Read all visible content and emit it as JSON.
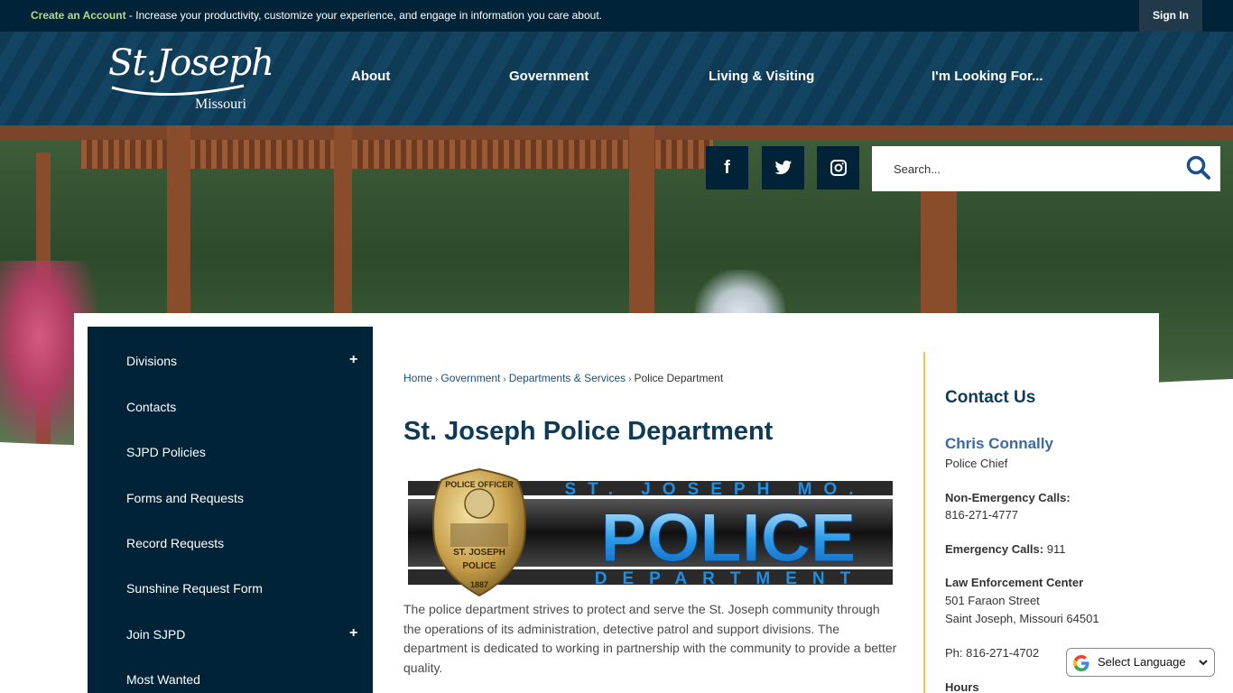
{
  "topbar": {
    "create_link": "Create an Account",
    "message": " - Increase your productivity, customize your experience, and engage in information you care about.",
    "sign_in": "Sign In"
  },
  "logo": {
    "city": "St.Joseph",
    "state": "Missouri"
  },
  "nav": [
    {
      "label": "About"
    },
    {
      "label": "Government"
    },
    {
      "label": "Living & Visiting"
    },
    {
      "label": "I'm Looking For..."
    }
  ],
  "social": {
    "facebook": "f",
    "twitter": "twitter-icon",
    "instagram": "instagram-icon"
  },
  "search": {
    "placeholder": "Search..."
  },
  "sidebar": {
    "items": [
      {
        "label": "Divisions",
        "expand": "+"
      },
      {
        "label": "Contacts"
      },
      {
        "label": "SJPD Policies"
      },
      {
        "label": "Forms and Requests"
      },
      {
        "label": "Record Requests"
      },
      {
        "label": "Sunshine Request Form"
      },
      {
        "label": "Join SJPD",
        "expand": "+"
      },
      {
        "label": "Most Wanted"
      }
    ]
  },
  "breadcrumb": {
    "items": [
      "Home",
      "Government",
      "Departments & Services"
    ],
    "current": "Police Department",
    "separator": "›"
  },
  "page": {
    "title": "St. Joseph Police Department",
    "banner": {
      "top_text": "ST. JOSEPH MO.",
      "main_text": "POLICE",
      "bottom_text": "DEPARTMENT",
      "badge_top": "POLICE OFFICER",
      "badge_mid": "ST. JOSEPH",
      "badge_low": "POLICE",
      "badge_number": "1887"
    },
    "description": "The police department strives to protect and serve the St. Joseph community through the operations of its administration, detective patrol and support divisions. The department is dedicated to working in partnership with the community to provide a better quality."
  },
  "contact": {
    "heading": "Contact Us",
    "name": "Chris Connally",
    "role": "Police Chief",
    "non_emergency_label": "Non-Emergency Calls:",
    "non_emergency_phone": "816-271-4777",
    "emergency_label": "Emergency Calls:",
    "emergency_phone": " 911",
    "location_label": "Law Enforcement Center",
    "street": "501 Faraon Street",
    "city": "Saint Joseph, Missouri 64501",
    "phone": "Ph: 816-271-4702",
    "hours_label": "Hours"
  },
  "language": {
    "label": "Select Language"
  },
  "colors": {
    "navy": "#012338",
    "accent_green": "#b4d98c",
    "divider_gold": "#f0c24a",
    "title_blue": "#0e3a56"
  }
}
